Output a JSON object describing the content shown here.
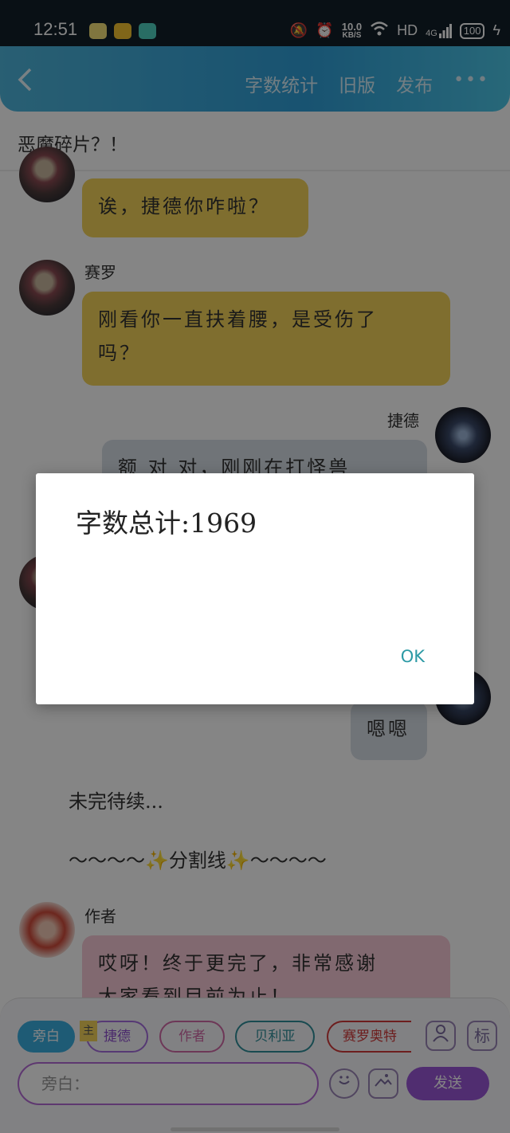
{
  "status_bar": {
    "time": "12:51",
    "net_speed_value": "10.0",
    "net_speed_unit": "KB/S",
    "hd_label": "HD",
    "signal_label": "4G",
    "battery": "100"
  },
  "header": {
    "actions": [
      "字数统计",
      "旧版",
      "发布"
    ],
    "more_label": "•••"
  },
  "subtitle": "恶魔碎片？！",
  "messages": {
    "m1_text": "诶，捷德你咋啦？",
    "m2_name": "赛罗",
    "m2_text_line1": "刚看你一直扶着腰，是受伤了",
    "m2_text_line2": "吗？",
    "m3_name": "捷德",
    "m3_text": "额 对 对，刚刚在打怪兽",
    "m4_text": "嗯嗯",
    "narration1": "未完待续...",
    "narration2": "～～～～✨分割线✨～～～～",
    "m5_name": "作者",
    "m5_text_line1": "哎呀！终于更完了，非常感谢",
    "m5_text_line2": "大家看到目前为止！"
  },
  "bottom": {
    "chips": {
      "narration": "旁白",
      "main_badge": "主",
      "jed": "捷德",
      "author": "作者",
      "bellia": "贝利亚",
      "zero": "赛罗奥特"
    },
    "tag_icon_label": "标",
    "input_placeholder": "旁白：",
    "send_label": "发送"
  },
  "dialog": {
    "message": "字数总计:1969",
    "ok_label": "OK"
  }
}
